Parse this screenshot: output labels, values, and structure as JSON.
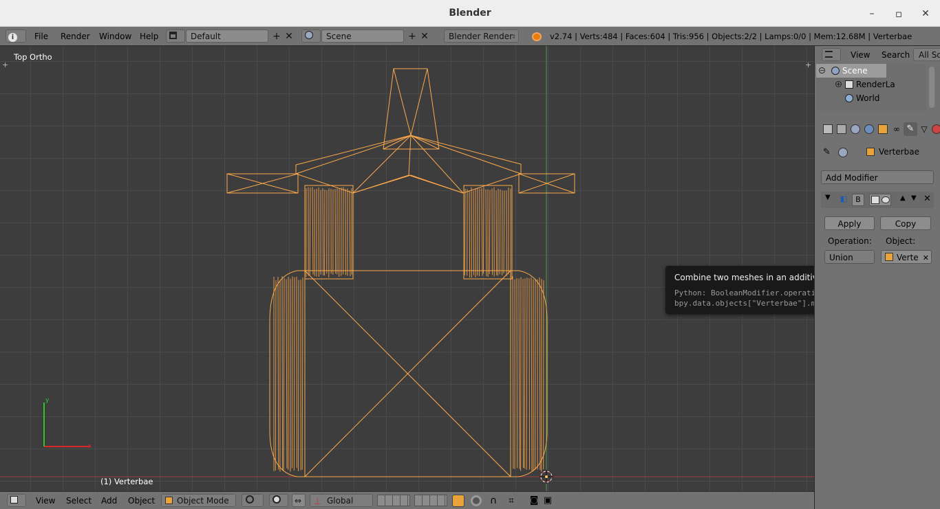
{
  "window": {
    "title": "Blender",
    "minimize": "–",
    "maximize": "▫",
    "close": "✕"
  },
  "topbar": {
    "menu": [
      "File",
      "Render",
      "Window",
      "Help"
    ],
    "screen_layout": "Default",
    "scene": "Scene",
    "engine": "Blender Render",
    "info": "v2.74 | Verts:484 | Faces:604 | Tris:956 | Objects:2/2 | Lamps:0/0 | Mem:12.68M | Verterbae"
  },
  "viewport": {
    "view_name": "Top Ortho",
    "object_label": "(1) Verterbae",
    "axis_x": "x",
    "axis_y": "y"
  },
  "bottombar": {
    "menu": [
      "View",
      "Select",
      "Add",
      "Object"
    ],
    "mode": "Object Mode",
    "orientation": "Global"
  },
  "outliner": {
    "menu": [
      "View",
      "Search"
    ],
    "filter": "All Sc",
    "tree": [
      "Scene",
      "RenderLa",
      "World"
    ]
  },
  "properties": {
    "object_name": "Verterbae",
    "add_modifier": "Add Modifier",
    "modifier_name": "B",
    "apply": "Apply",
    "copy": "Copy",
    "operation_label": "Operation:",
    "object_label": "Object:",
    "operation_value": "Union",
    "object_value": "Verte"
  },
  "tooltip": {
    "title": "Combine two meshes in an additive way",
    "python": "Python: BooleanModifier.operation",
    "path": "bpy.data.objects[\"Verterbae\"].modifiers[\"Boolean\"].operation"
  },
  "colors": {
    "wire": "#ffaa4c",
    "wire_light": "#ffc98a",
    "axis_x": "#c83232",
    "axis_y": "#2ec82e"
  }
}
